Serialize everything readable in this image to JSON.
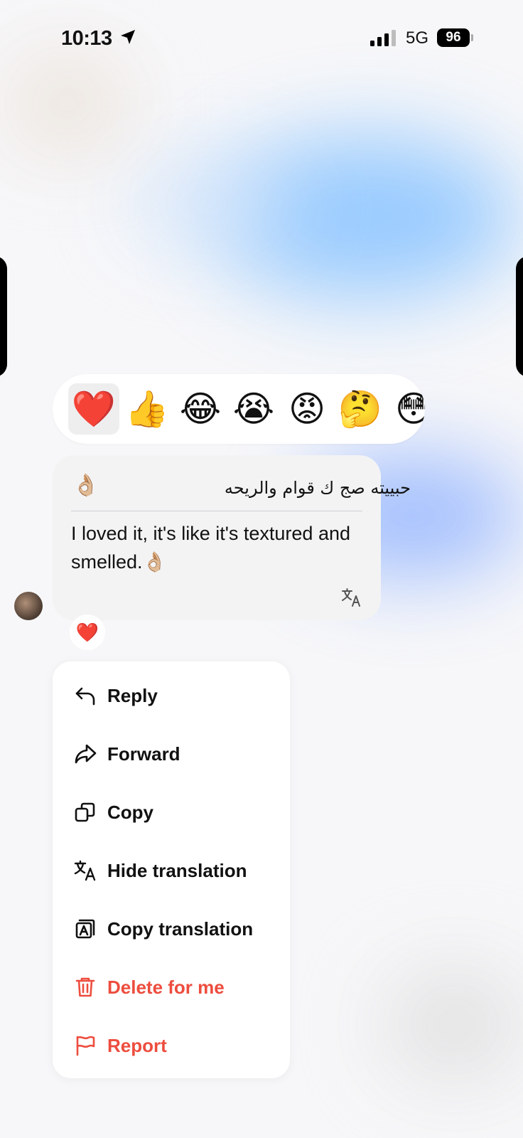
{
  "status_bar": {
    "time": "10:13",
    "network": "5G",
    "battery": "96",
    "icons": [
      "location-arrow-icon",
      "signal-bars-icon",
      "battery-icon"
    ]
  },
  "reactions": {
    "items": [
      {
        "emoji": "❤️",
        "name": "red-heart",
        "selected": true
      },
      {
        "emoji": "👍",
        "name": "thumbs-up",
        "selected": false
      },
      {
        "emoji": "😂",
        "name": "tears-of-joy",
        "selected": false
      },
      {
        "emoji": "😭",
        "name": "loudly-crying",
        "selected": false
      },
      {
        "emoji": "😡",
        "name": "angry-face",
        "selected": false
      },
      {
        "emoji": "🤔",
        "name": "thinking-face",
        "selected": false
      },
      {
        "emoji": "😳",
        "name": "flushed-face",
        "selected": false
      }
    ]
  },
  "message": {
    "original_text": "حبييته صج ك قوام والريحه",
    "original_emoji": "👌🏼",
    "translation": "I loved it, it's like it's textured and smelled.👌🏼",
    "reaction": "❤️",
    "icons": [
      "translate-icon",
      "avatar"
    ]
  },
  "menu": {
    "items": [
      {
        "label": "Reply",
        "icon": "reply-icon",
        "danger": false
      },
      {
        "label": "Forward",
        "icon": "forward-icon",
        "danger": false
      },
      {
        "label": "Copy",
        "icon": "copy-icon",
        "danger": false
      },
      {
        "label": "Hide translation",
        "icon": "translate-icon",
        "danger": false
      },
      {
        "label": "Copy translation",
        "icon": "copy-translation-icon",
        "danger": false
      },
      {
        "label": "Delete for me",
        "icon": "trash-icon",
        "danger": true
      },
      {
        "label": "Report",
        "icon": "flag-icon",
        "danger": true
      }
    ]
  },
  "colors": {
    "danger": "#ed4d3e",
    "bubble": "#f3f3f4",
    "menu_bg": "#ffffff"
  }
}
